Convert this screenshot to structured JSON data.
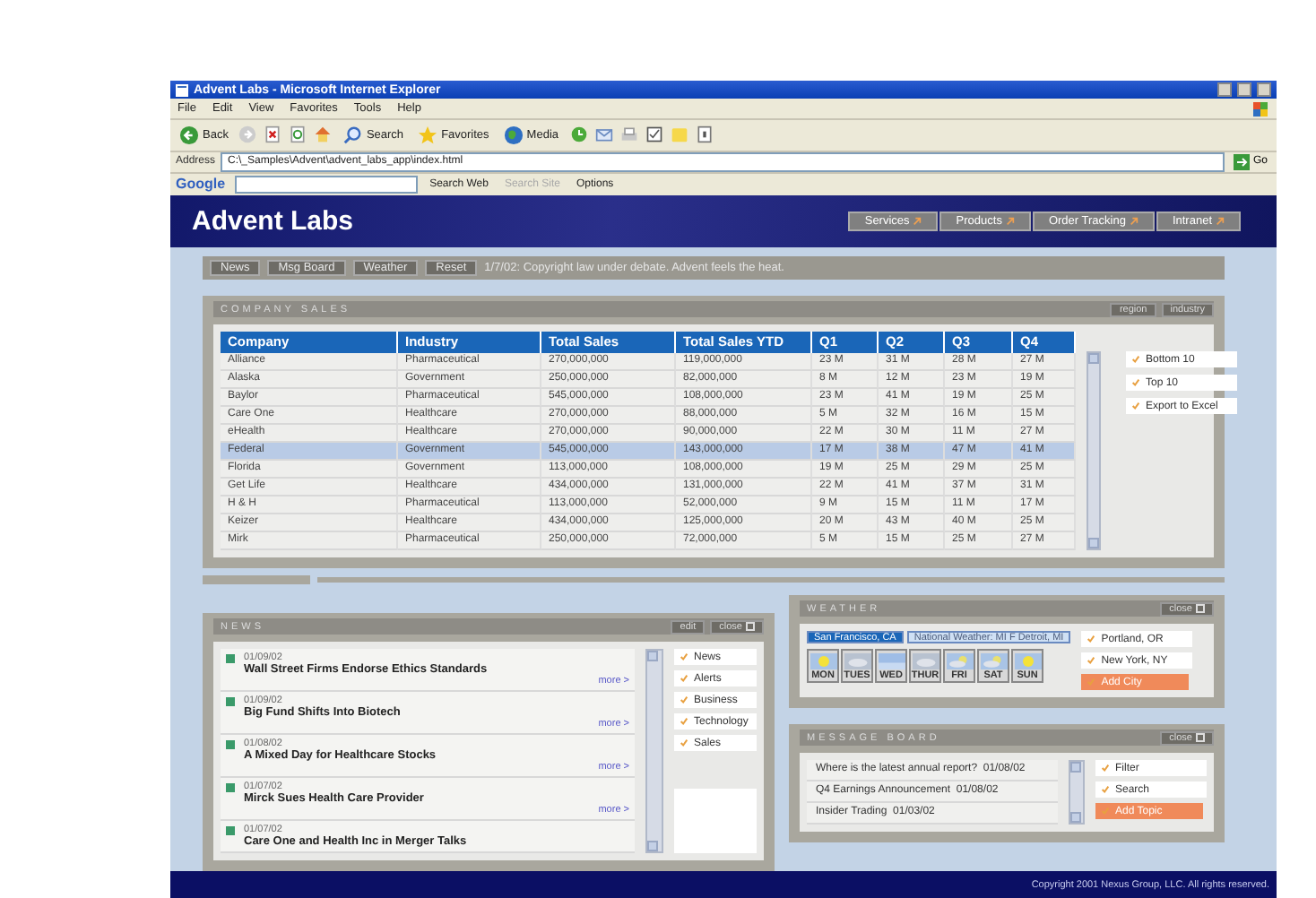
{
  "window": {
    "title": "Advent Labs - Microsoft Internet Explorer"
  },
  "menu": [
    "File",
    "Edit",
    "View",
    "Favorites",
    "Tools",
    "Help"
  ],
  "toolbar": [
    {
      "label": "Back",
      "kind": "back"
    },
    {
      "label": "Search",
      "kind": "search"
    },
    {
      "label": "Favorites",
      "kind": "favorites"
    },
    {
      "label": "Media",
      "kind": "media"
    }
  ],
  "address": {
    "label": "Address",
    "value": "C:\\_Samples\\Advent\\advent_labs_app\\index.html",
    "go": "Go"
  },
  "google_bar": {
    "logo": "Google",
    "search_web": "Search Web",
    "search_site": {
      "label": "Search Site",
      "disabled": true
    },
    "options": "Options"
  },
  "site": {
    "title": "Advent Labs",
    "nav": [
      "Services",
      "Products",
      "Order Tracking",
      "Intranet"
    ]
  },
  "quick_bar": {
    "buttons": [
      "News",
      "Msg Board",
      "Weather",
      "Reset"
    ],
    "ticker": "1/7/02:  Copyright law under debate. Advent feels the heat."
  },
  "company_sales": {
    "title": "COMPANY SALES",
    "header_buttons": [
      "region",
      "industry"
    ],
    "columns": [
      "Company",
      "Industry",
      "Total Sales",
      "Total Sales YTD",
      "Q1",
      "Q2",
      "Q3",
      "Q4"
    ],
    "rows": [
      {
        "cells": [
          "Alliance",
          "Pharmaceutical",
          "270,000,000",
          "119,000,000",
          "23 M",
          "31 M",
          "28 M",
          "27 M"
        ],
        "selected": false
      },
      {
        "cells": [
          "Alaska",
          "Government",
          "250,000,000",
          "82,000,000",
          "8 M",
          "12 M",
          "23 M",
          "19 M"
        ],
        "selected": false
      },
      {
        "cells": [
          "Baylor",
          "Pharmaceutical",
          "545,000,000",
          "108,000,000",
          "23 M",
          "41 M",
          "19 M",
          "25 M"
        ],
        "selected": false
      },
      {
        "cells": [
          "Care One",
          "Healthcare",
          "270,000,000",
          "88,000,000",
          "5 M",
          "32 M",
          "16 M",
          "15 M"
        ],
        "selected": false
      },
      {
        "cells": [
          "eHealth",
          "Healthcare",
          "270,000,000",
          "90,000,000",
          "22 M",
          "30 M",
          "11 M",
          "27 M"
        ],
        "selected": false
      },
      {
        "cells": [
          "Federal",
          "Government",
          "545,000,000",
          "143,000,000",
          "17 M",
          "38 M",
          "47 M",
          "41 M"
        ],
        "selected": true
      },
      {
        "cells": [
          "Florida",
          "Government",
          "113,000,000",
          "108,000,000",
          "19 M",
          "25 M",
          "29 M",
          "25 M"
        ],
        "selected": false
      },
      {
        "cells": [
          "Get Life",
          "Healthcare",
          "434,000,000",
          "131,000,000",
          "22 M",
          "41 M",
          "37 M",
          "31 M"
        ],
        "selected": false
      },
      {
        "cells": [
          "H & H",
          "Pharmaceutical",
          "113,000,000",
          "52,000,000",
          "9 M",
          "15 M",
          "11 M",
          "17 M"
        ],
        "selected": false
      },
      {
        "cells": [
          "Keizer",
          "Healthcare",
          "434,000,000",
          "125,000,000",
          "20 M",
          "43 M",
          "40 M",
          "25 M"
        ],
        "selected": false
      },
      {
        "cells": [
          "Mirk",
          "Pharmaceutical",
          "250,000,000",
          "72,000,000",
          "5 M",
          "15 M",
          "25 M",
          "27 M"
        ],
        "selected": false
      }
    ],
    "actions": [
      "Bottom 10",
      "Top 10",
      "Export to Excel"
    ]
  },
  "news": {
    "title": "NEWS",
    "header_buttons": [
      "edit",
      "close"
    ],
    "items": [
      {
        "date": "01/09/02",
        "headline": "Wall Street Firms Endorse Ethics Standards",
        "more": "more >"
      },
      {
        "date": "01/09/02",
        "headline": "Big Fund Shifts Into Biotech",
        "more": "more >"
      },
      {
        "date": "01/08/02",
        "headline": "A Mixed Day for Healthcare Stocks",
        "more": "more >"
      },
      {
        "date": "01/07/02",
        "headline": "Mirck Sues Health Care Provider",
        "more": "more >"
      },
      {
        "date": "01/07/02",
        "headline": "Care One and Health Inc in Merger Talks"
      }
    ],
    "categories": [
      "News",
      "Alerts",
      "Business",
      "Technology",
      "Sales"
    ]
  },
  "weather": {
    "title": "WEATHER",
    "close": "close",
    "tabs": [
      {
        "label": "San Francisco, CA",
        "selected": true
      },
      {
        "label": "National Weather: MI F Detroit, MI",
        "selected": false
      }
    ],
    "days": [
      {
        "label": "MON",
        "kind": "sunny"
      },
      {
        "label": "TUES",
        "kind": "cloudy"
      },
      {
        "label": "WED",
        "kind": "sky"
      },
      {
        "label": "THUR",
        "kind": "cloudy"
      },
      {
        "label": "FRI",
        "kind": "partly"
      },
      {
        "label": "SAT",
        "kind": "partly"
      },
      {
        "label": "SUN",
        "kind": "sunny"
      }
    ],
    "cities": [
      "Portland, OR",
      "New York, NY"
    ],
    "add": "Add City"
  },
  "message_board": {
    "title": "MESSAGE BOARD",
    "close": "close",
    "messages": [
      "Where is the latest annual report?  01/08/02",
      "Q4 Earnings Announcement  01/08/02",
      "Insider Trading  01/03/02"
    ],
    "actions": [
      "Filter",
      "Search"
    ],
    "add": "Add Topic"
  },
  "footer": "Copyright 2001 Nexus Group, LLC. All rights reserved."
}
